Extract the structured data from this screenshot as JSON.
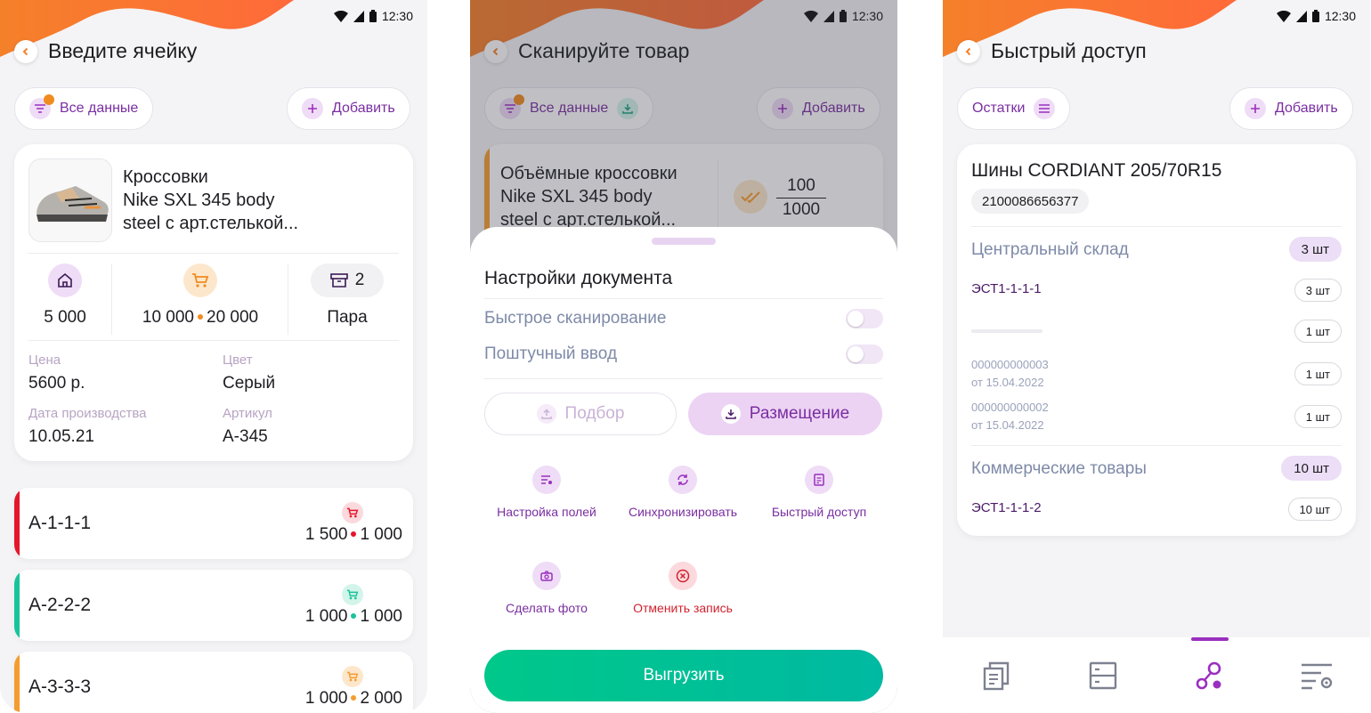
{
  "status": {
    "time": "12:30"
  },
  "screen1": {
    "title": "Введите ячейку",
    "filter_label": "Все данные",
    "add_label": "Добавить",
    "product": {
      "name_line1": "Кроссовки",
      "name_line2": "Nike SXL 345 body",
      "name_line3": "steel с арт.стелькой...",
      "stock_home": "5 000",
      "stock_cart_a": "10 000",
      "stock_cart_b": "20 000",
      "box_count": "2",
      "unit": "Пара",
      "price_label": "Цена",
      "price_value": "5600 р.",
      "color_label": "Цвет",
      "color_value": "Серый",
      "date_label": "Дата производства",
      "date_value": "10.05.21",
      "article_label": "Артикул",
      "article_value": "A-345"
    },
    "cells": [
      {
        "code": "A-1-1-1",
        "a": "1 500",
        "b": "1 000",
        "color": "#e3162b",
        "icon_bg": "#fbd9dd",
        "icon_color": "#e3162b"
      },
      {
        "code": "A-2-2-2",
        "a": "1 000",
        "b": "1 000",
        "color": "#19c39a",
        "icon_bg": "#d3f4ea",
        "icon_color": "#19c39a"
      },
      {
        "code": "A-3-3-3",
        "a": "1 000",
        "b": "2 000",
        "color": "#f59c2f",
        "icon_bg": "#fde7cc",
        "icon_color": "#f59c2f"
      }
    ]
  },
  "screen2": {
    "title": "Сканируйте товар",
    "filter_label": "Все данные",
    "add_label": "Добавить",
    "item_line1": "Объёмные кроссовки",
    "item_line2": "Nike SXL 345 body",
    "item_line3": "steel с арт.стелькой...",
    "count_done": "100",
    "count_total": "1000",
    "sheet_title": "Настройки документа",
    "toggle_fast": "Быстрое сканирование",
    "toggle_single": "Поштучный ввод",
    "seg_pick": "Подбор",
    "seg_place": "Размещение",
    "actions": {
      "fields": "Настройка полей",
      "sync": "Синхронизировать",
      "quick": "Быстрый доступ",
      "photo": "Сделать фото",
      "cancel": "Отменить запись"
    },
    "upload": "Выгрузить"
  },
  "screen3": {
    "title": "Быстрый доступ",
    "rest_label": "Остатки",
    "add_label": "Добавить",
    "product_name": "Шины CORDIANT 205/70R15",
    "barcode": "2100086656377",
    "warehouse1": {
      "name": "Центральный склад",
      "qty": "3 шт"
    },
    "row1": {
      "code": "ЭСТ1-1-1-1",
      "qty": "3 шт"
    },
    "row2": {
      "qty": "1 шт"
    },
    "doc1": {
      "num": "000000000003",
      "date": "от 15.04.2022",
      "qty": "1 шт"
    },
    "doc2": {
      "num": "000000000002",
      "date": "от 15.04.2022",
      "qty": "1 шт"
    },
    "warehouse2": {
      "name": "Коммерческие товары",
      "qty": "10 шт"
    },
    "row3": {
      "code": "ЭСТ1-1-1-2",
      "qty": "10 шт"
    }
  },
  "colors": {
    "accent": "#9a2fbf",
    "brand_orange": "#f5802a",
    "green": "#00c88a"
  }
}
